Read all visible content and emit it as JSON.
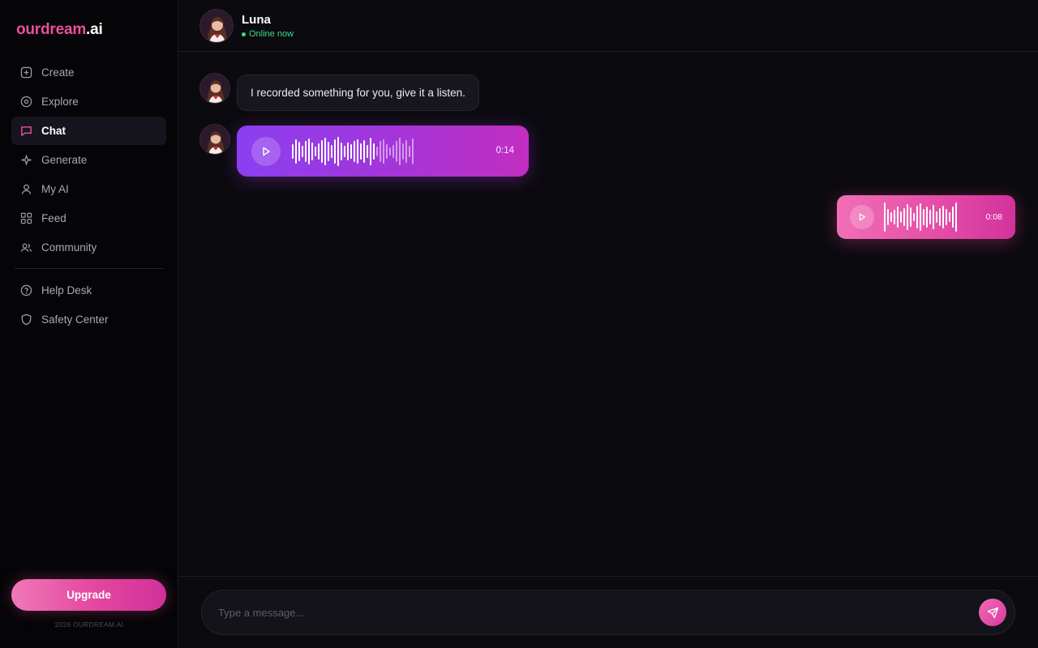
{
  "brand": {
    "name": "ourdream",
    "tld": ".ai"
  },
  "sidebar": {
    "items": [
      {
        "label": "Create",
        "icon": "plus-square-icon",
        "active": false
      },
      {
        "label": "Explore",
        "icon": "compass-icon",
        "active": false
      },
      {
        "label": "Chat",
        "icon": "chat-bubble-icon",
        "active": true
      },
      {
        "label": "Generate",
        "icon": "sparkle-icon",
        "active": false
      },
      {
        "label": "My AI",
        "icon": "user-icon",
        "active": false
      },
      {
        "label": "Feed",
        "icon": "grid-icon",
        "active": false
      }
    ],
    "community": {
      "label": "Community",
      "icon": "users-icon"
    },
    "secondary": [
      {
        "label": "Help Desk",
        "icon": "help-circle-icon"
      },
      {
        "label": "Safety Center",
        "icon": "shield-icon"
      }
    ],
    "upgrade_label": "Upgrade",
    "copyright": "2026 OURDREAM.AI"
  },
  "chat": {
    "contact_name": "Luna",
    "status": "Online now",
    "messages": [
      {
        "from": "ai",
        "type": "text",
        "text": "I recorded something for you, give it a listen."
      },
      {
        "from": "ai",
        "type": "voice",
        "duration": "0:14"
      },
      {
        "from": "user",
        "type": "voice",
        "duration": "0:08"
      }
    ]
  },
  "composer": {
    "placeholder": "Type a message..."
  },
  "colors": {
    "accent": "#ec4f9d",
    "online": "#3ddc84",
    "ai_bubble_start": "#8b3ff0",
    "ai_bubble_end": "#c22ec0",
    "user_bubble_start": "#f16fb6",
    "user_bubble_end": "#d2339c"
  }
}
